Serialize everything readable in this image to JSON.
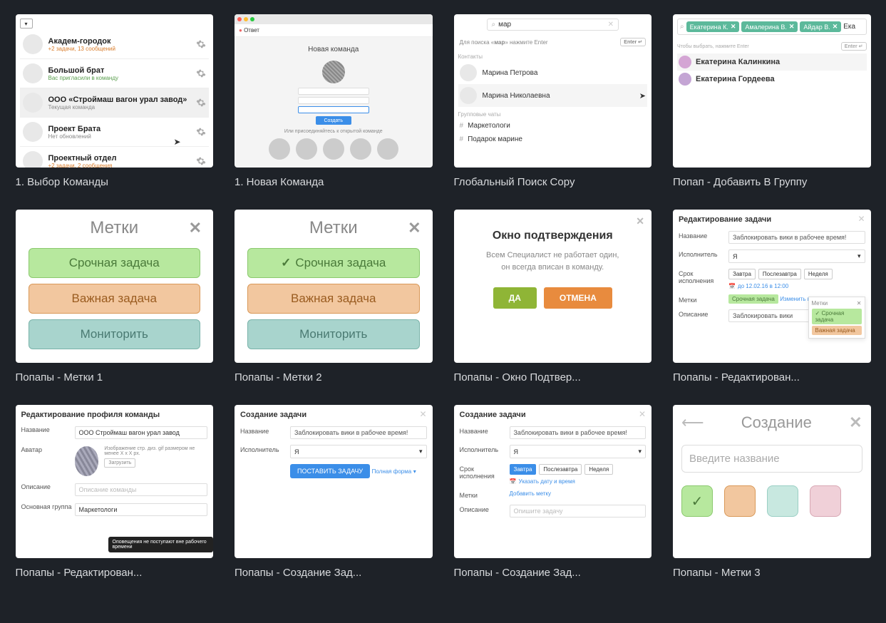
{
  "cards": [
    {
      "caption": "1. Выбор Команды"
    },
    {
      "caption": "1. Новая Команда"
    },
    {
      "caption": "Глобальный Поиск Copy"
    },
    {
      "caption": "Попап - Добавить В Группу"
    },
    {
      "caption": "Попапы - Метки 1"
    },
    {
      "caption": "Попапы - Метки 2"
    },
    {
      "caption": "Попапы - Окно Подтвер..."
    },
    {
      "caption": "Попапы - Редактирован..."
    },
    {
      "caption": "Попапы - Редактирован..."
    },
    {
      "caption": "Попапы - Создание Зад..."
    },
    {
      "caption": "Попапы - Создание Зад..."
    },
    {
      "caption": "Попапы - Метки 3"
    }
  ],
  "t1": {
    "rows": [
      {
        "name": "Академ-городок",
        "sub": "+2 задачи, 13 сообщений",
        "cls": "or"
      },
      {
        "name": "Большой брат",
        "sub": "Вас пригласили в команду",
        "cls": "gr"
      },
      {
        "name": "ООО «Строймаш вагон урал завод»",
        "sub": "Текущая команда",
        "cls": "",
        "sel": true
      },
      {
        "name": "Проект Брата",
        "sub": "Нет обновлений",
        "cls": ""
      },
      {
        "name": "Проектный отдел",
        "sub": "+2 задачи, 2 сообщения",
        "cls": "or"
      }
    ]
  },
  "t2": {
    "brand": "Ответ",
    "title": "Новая команда",
    "btn": "Создать",
    "or": "Или присоединяйтесь к открытой команде"
  },
  "t3": {
    "query": "мар",
    "tip_pre": "Для поиска «",
    "tip_q": "мар",
    "tip_post": "» нажмите Enter",
    "enter": "Enter ↵",
    "sec_contacts": "Контакты",
    "contacts": [
      "Марина Петрова",
      "Марина Николаевна"
    ],
    "sec_groups": "Групповые чаты",
    "groups": [
      "Маркетологи",
      "Подарок марине"
    ]
  },
  "t4": {
    "chips": [
      "Екатерина К.",
      "Амалерина В.",
      "Айдар В."
    ],
    "typed": "Ека",
    "tip": "Чтобы выбрать, нажмите Enter",
    "enter": "Enter ↵",
    "people": [
      "Екатерина Калинкина",
      "Екатерина Гордеева"
    ]
  },
  "t5": {
    "title": "Метки",
    "labels": [
      "Срочная задача",
      "Важная задача",
      "Мониторить"
    ]
  },
  "t6": {
    "title": "Метки",
    "labels": [
      "Срочная задача",
      "Важная задача",
      "Мониторить"
    ]
  },
  "t7": {
    "title": "Окно подтверждения",
    "msg1": "Всем Специалист не работает один,",
    "msg2": "он всегда вписан в команду.",
    "yes": "ДА",
    "no": "ОТМЕНА"
  },
  "t8": {
    "title": "Редактирование задачи",
    "f_name": "Название",
    "v_name": "Заблокировать вики в рабочее время!",
    "f_exec": "Исполнитель",
    "v_exec": "Я",
    "f_due": "Срок исполнения",
    "due_opts": [
      "Завтра",
      "Послезавтра",
      "Неделя"
    ],
    "due_date": "до 12.02.16 в 12:00",
    "f_labels": "Метки",
    "label_1": "Срочная задача",
    "label_change": "Изменить метки",
    "f_desc": "Описание",
    "v_desc": "Заблокировать вики",
    "pop_title": "Метки",
    "pop_1": "Срочная задача",
    "pop_2": "Важная задача"
  },
  "t9": {
    "title": "Редактирование профиля команды",
    "f_name": "Название",
    "v_name": "ООО Строймаш вагон урал завод",
    "f_avatar": "Аватар",
    "av_hint": "Изображение стр. диз. gif\nразмером не менее X x X px.",
    "upload": "Загрузить",
    "f_desc": "Описание",
    "ph_desc": "Описание команды",
    "f_group": "Основная группа",
    "v_group": "Маркетологи",
    "tooltip": "Оповещения не поступают вне рабочего времени"
  },
  "t10": {
    "title": "Создание задачи",
    "f_name": "Название",
    "v_name": "Заблокировать вики в рабочее время!",
    "f_exec": "Исполнитель",
    "v_exec": "Я",
    "submit": "ПОСТАВИТЬ ЗАДАЧУ",
    "full": "Полная форма"
  },
  "t11": {
    "title": "Создание задачи",
    "f_name": "Название",
    "v_name": "Заблокировать вики в рабочее время!",
    "f_exec": "Исполнитель",
    "v_exec": "Я",
    "f_due": "Срок исполнения",
    "due_opts": [
      "Завтра",
      "Послезавтра",
      "Неделя"
    ],
    "due_link": "Указать дату и время",
    "f_labels": "Метки",
    "add_label": "Добавить метку",
    "f_desc": "Описание",
    "ph_desc": "Опишите задачу"
  },
  "t12": {
    "title": "Создание",
    "placeholder": "Введите название"
  }
}
